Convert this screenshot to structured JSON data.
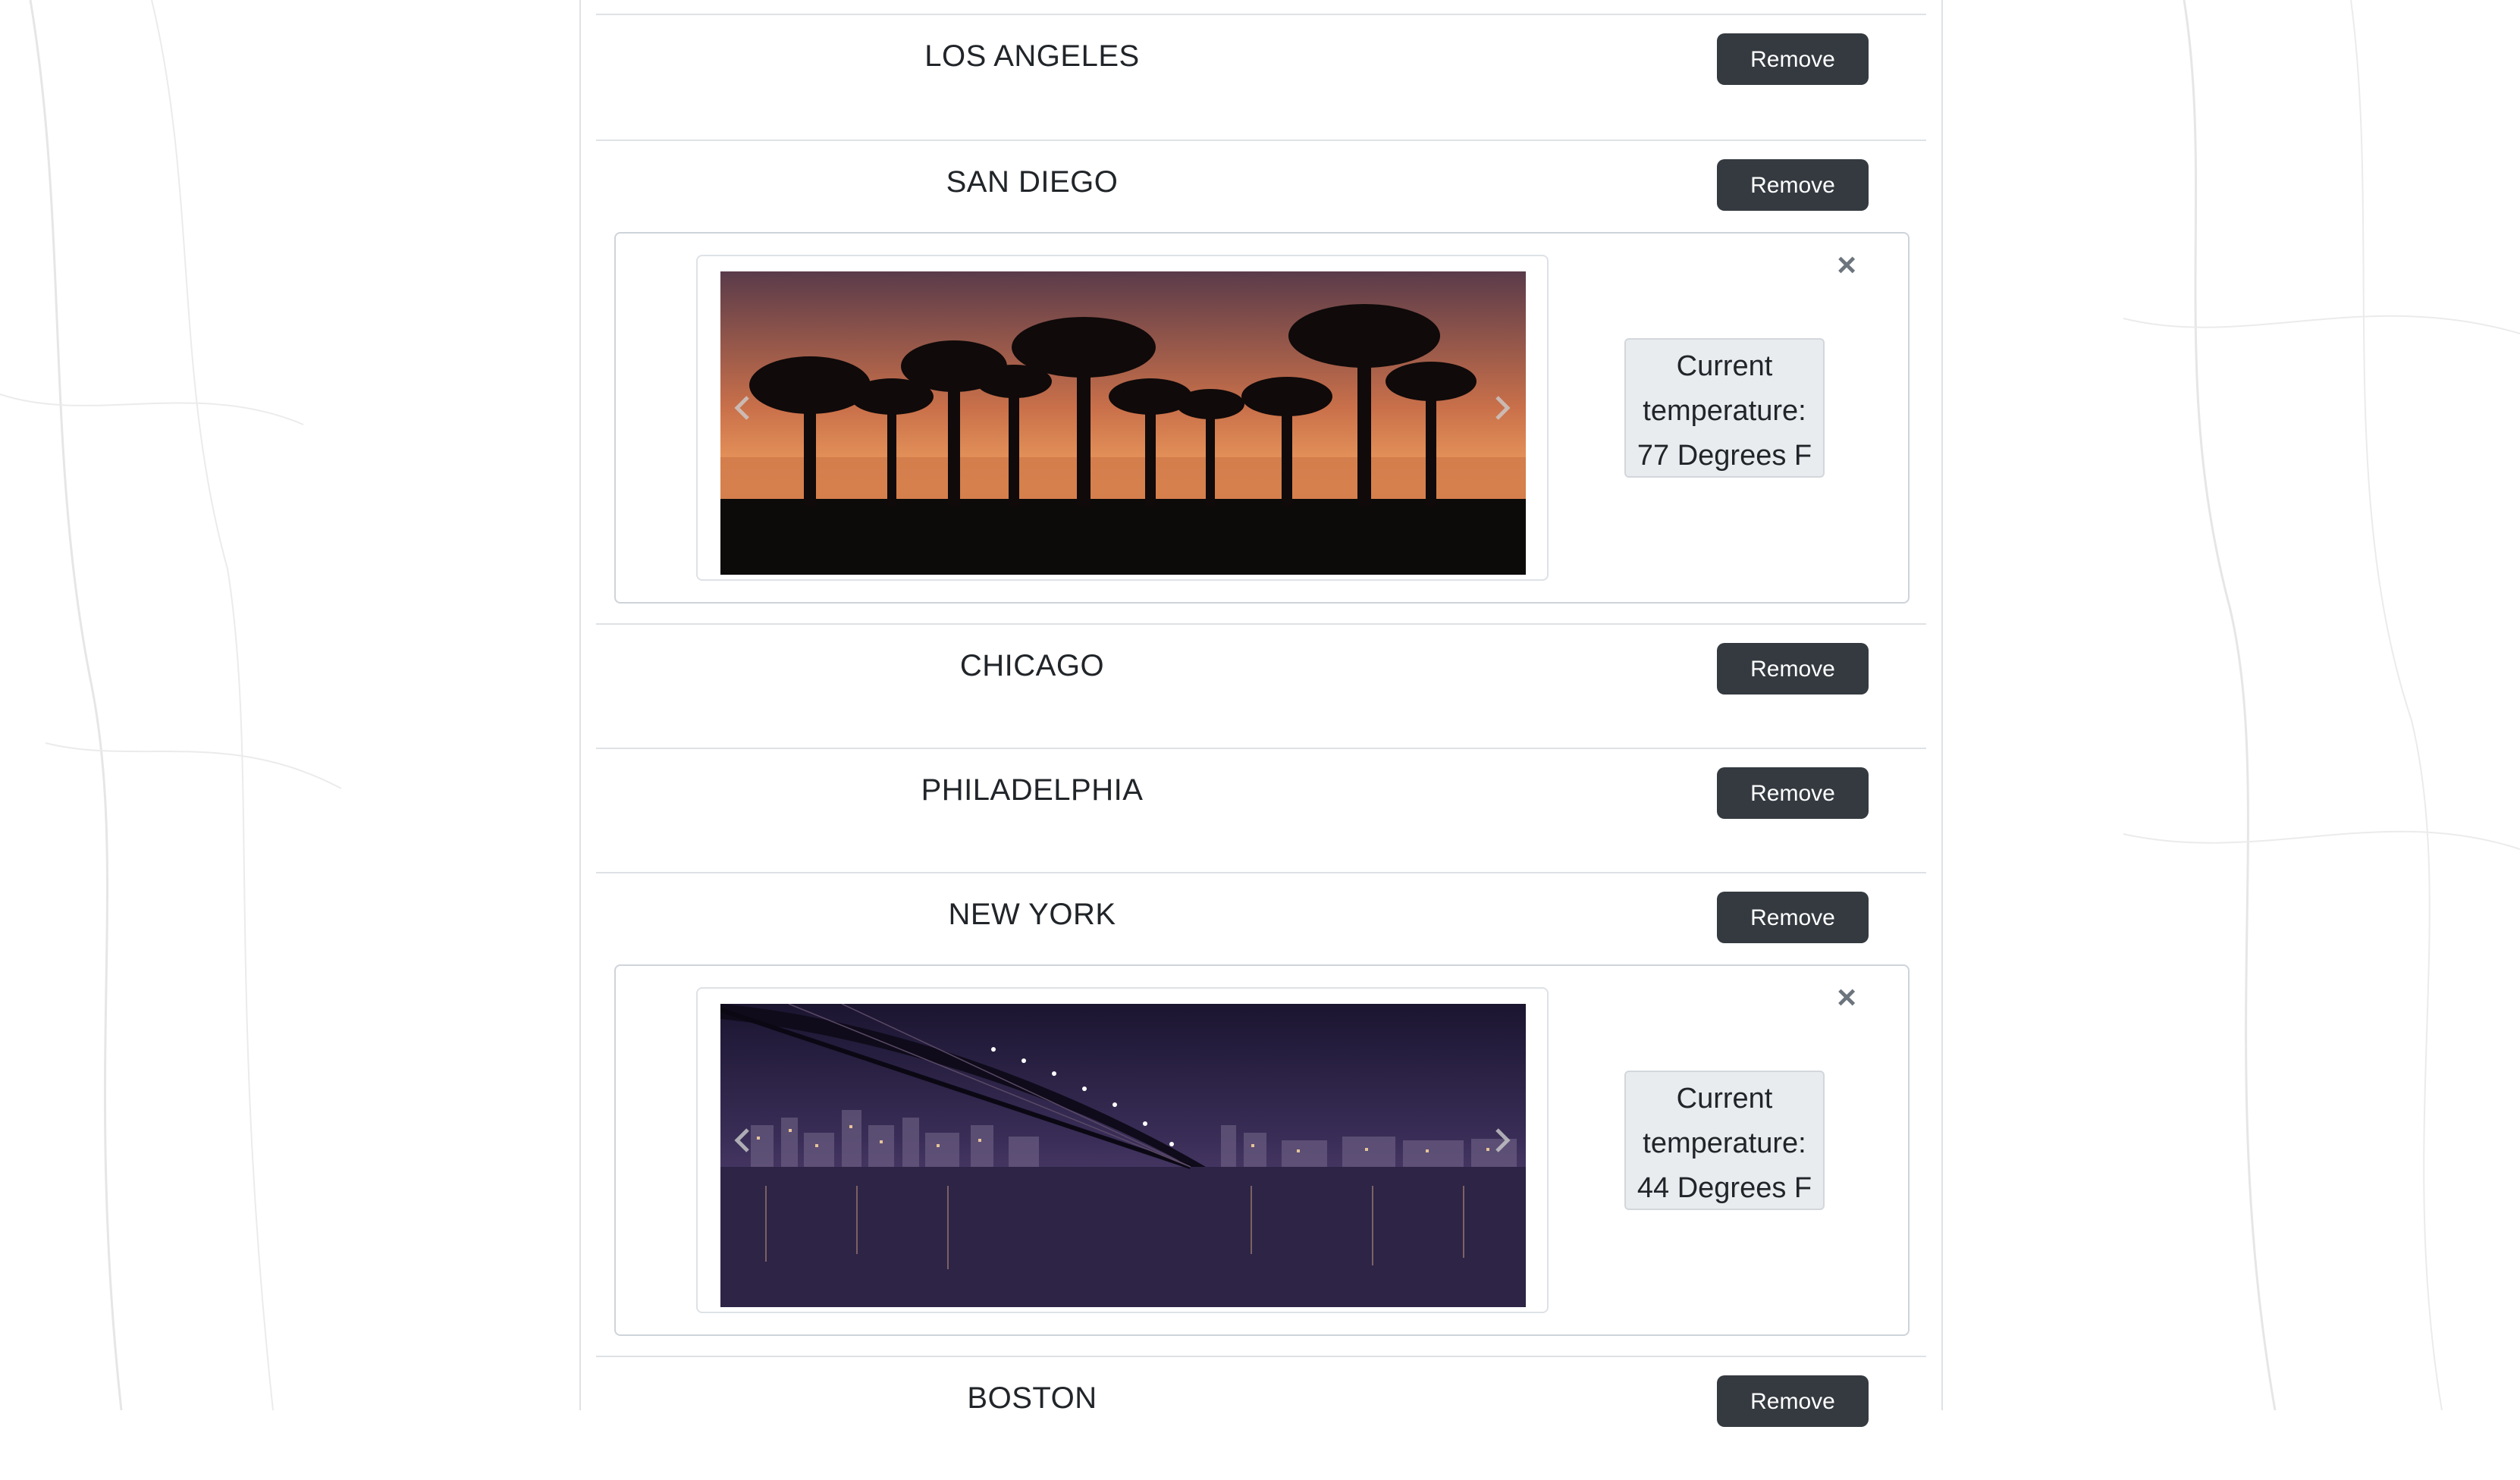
{
  "cities": [
    {
      "name": "LOS ANGELES",
      "remove_label": "Remove"
    },
    {
      "name": "SAN DIEGO",
      "remove_label": "Remove",
      "detail": {
        "close_label": "×",
        "image_icon": "palm-sunset-photo",
        "temp_lines": [
          "Current",
          "temperature:",
          "77 Degrees F"
        ]
      }
    },
    {
      "name": "CHICAGO",
      "remove_label": "Remove"
    },
    {
      "name": "PHILADELPHIA",
      "remove_label": "Remove"
    },
    {
      "name": "NEW YORK",
      "remove_label": "Remove",
      "detail": {
        "close_label": "×",
        "image_icon": "bridge-skyline-night-photo",
        "temp_lines": [
          "Current",
          "temperature:",
          "44 Degrees F"
        ]
      }
    },
    {
      "name": "BOSTON",
      "remove_label": "Remove"
    }
  ],
  "colors": {
    "button_bg": "#343a40",
    "button_text": "#ffffff",
    "temp_bg": "#e9ecef",
    "divider": "#dee2e6"
  },
  "icons": {
    "carousel_prev": "chevron-left-icon",
    "carousel_next": "chevron-right-icon",
    "close": "close-icon"
  }
}
